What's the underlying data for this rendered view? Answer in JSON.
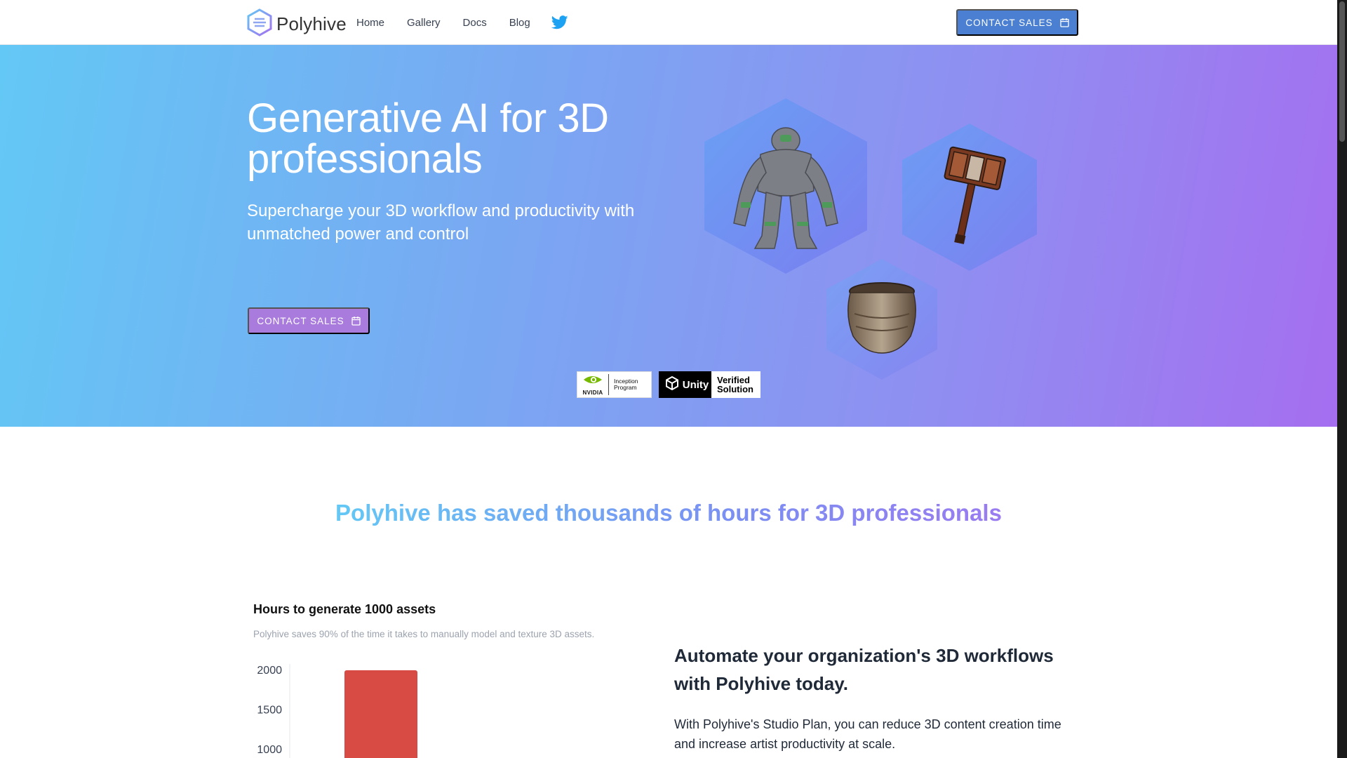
{
  "header": {
    "brand_name": "Polyhive",
    "nav": [
      "Home",
      "Gallery",
      "Docs",
      "Blog"
    ],
    "contact_label": "CONTACT SALES"
  },
  "hero": {
    "title": "Generative AI for 3D professionals",
    "subtitle": "Supercharge your 3D workflow and productivity with unmatched power and control",
    "contact_label": "CONTACT SALES",
    "badges": {
      "nvidia_word": "NVIDIA",
      "nvidia_line1": "Inception",
      "nvidia_line2": "Program",
      "unity_word": "Unity",
      "unity_line1": "Verified",
      "unity_line2": "Solution"
    }
  },
  "tagline": "Polyhive has saved thousands of hours for 3D professionals",
  "chart_section": {
    "title": "Hours to generate 1000 assets",
    "subtitle": "Polyhive saves 90% of the time it takes to manually model and texture 3D assets."
  },
  "chart_data": {
    "type": "bar",
    "categories": [
      ""
    ],
    "values": [
      2000
    ],
    "ylim": [
      0,
      2000
    ],
    "yticks": [
      "2000",
      "1500",
      "1000"
    ],
    "bar_color": "#d84b45"
  },
  "automate": {
    "title": "Automate your organization's 3D workflows with Polyhive today.",
    "body": "With Polyhive's Studio Plan, you can reduce 3D content creation time and increase artist productivity at scale."
  },
  "colors": {
    "header_button": "#4a7fd1",
    "hero_button": "#a87bdc",
    "twitter": "#1da1f2"
  }
}
